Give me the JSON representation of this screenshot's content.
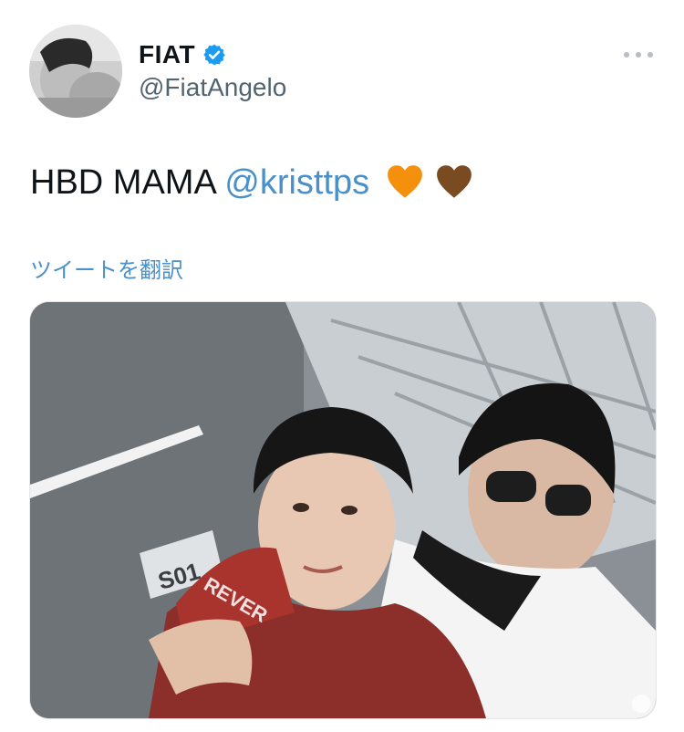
{
  "author": {
    "display_name": "FIAT",
    "handle": "@FiatAngelo",
    "verified": true
  },
  "tweet": {
    "text_prefix": "HBD MAMA ",
    "mention": "@kristtps",
    "emojis": [
      "orange-heart-icon",
      "brown-heart-icon"
    ],
    "translate_label": "ツイートを翻訳"
  },
  "media": {
    "sign_text": "S01",
    "jersey_text": "REVER"
  },
  "colors": {
    "link": "#4a90c9",
    "verified": "#1d9bf0",
    "text": "#0f1419",
    "secondary": "#536471",
    "orange_heart": "#f4900c",
    "brown_heart": "#7a4a20"
  }
}
